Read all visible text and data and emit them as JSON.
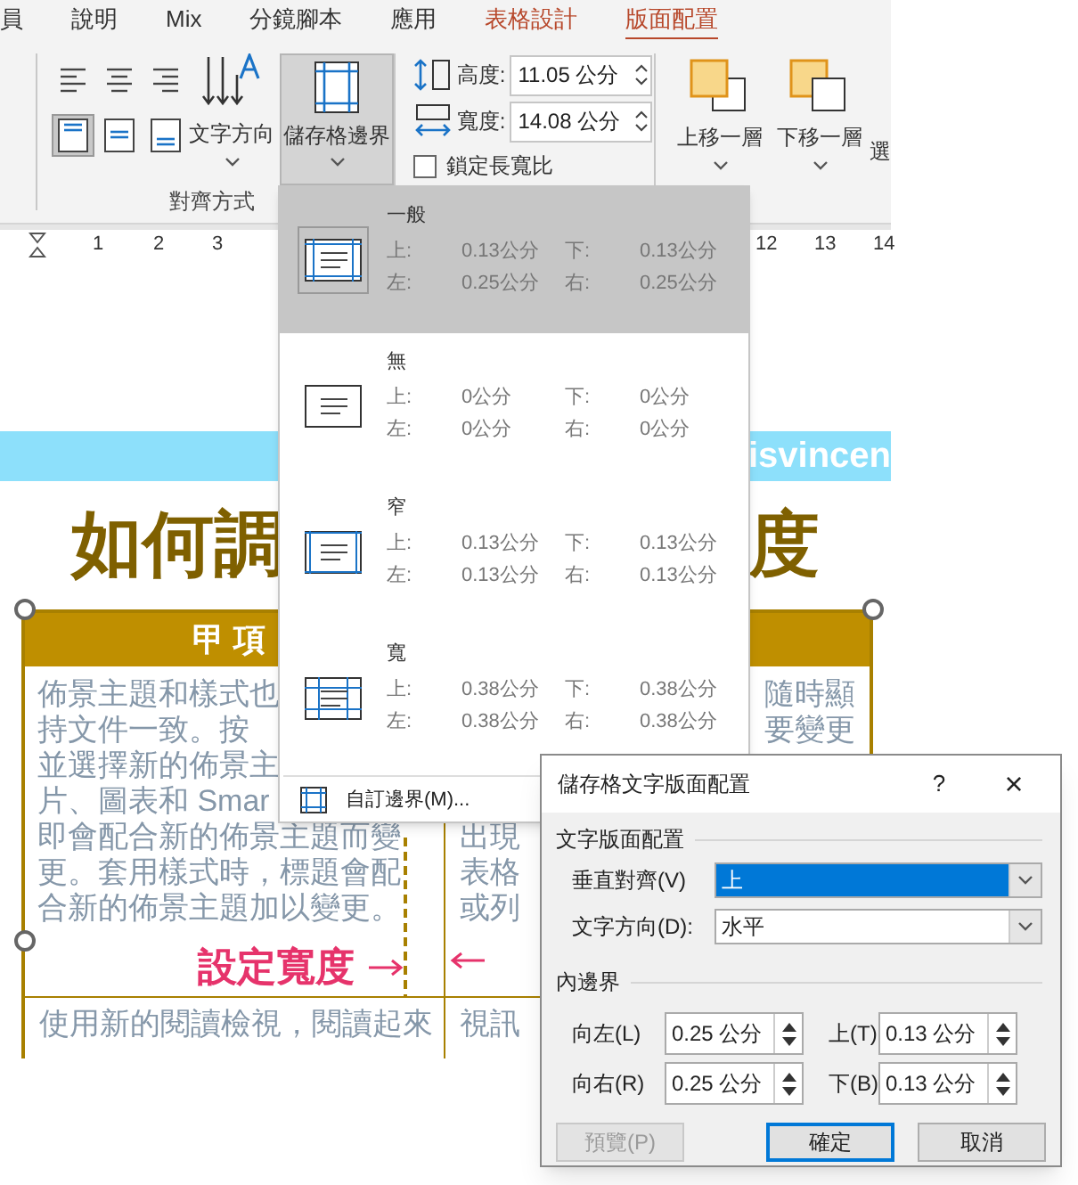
{
  "ribbon_tabs": [
    {
      "label": "員",
      "selected": false,
      "contextual": false
    },
    {
      "label": "說明",
      "selected": false,
      "contextual": false
    },
    {
      "label": "Mix",
      "selected": false,
      "contextual": false
    },
    {
      "label": "分鏡腳本",
      "selected": false,
      "contextual": false
    },
    {
      "label": "應用",
      "selected": false,
      "contextual": false
    },
    {
      "label": "表格設計",
      "selected": false,
      "contextual": true
    },
    {
      "label": "版面配置",
      "selected": true,
      "contextual": true
    }
  ],
  "ribbon": {
    "vertical_align_buttons": [
      {
        "selected": true
      },
      {
        "selected": false
      },
      {
        "selected": false
      }
    ],
    "text_direction_button": "文字方向",
    "cell_margins_button": {
      "label": "儲存格邊界",
      "pressed": true
    },
    "group_label": "對齊方式",
    "height": {
      "label": "高度:",
      "value": "11.05 公分"
    },
    "width": {
      "label": "寬度:",
      "value": "14.08 公分"
    },
    "lock_aspect": {
      "label": "鎖定長寬比",
      "checked": false
    },
    "arrange_buttons": [
      {
        "label": "上移一層",
        "kind": "forward"
      },
      {
        "label": "下移一層",
        "kind": "backward"
      },
      {
        "label": "選",
        "kind": "text"
      }
    ]
  },
  "ruler_labels": [
    "1",
    "2",
    "3",
    "12",
    "13",
    "14"
  ],
  "document": {
    "banner_text": "isvincen",
    "title_parts": [
      "如何調",
      "度"
    ],
    "table_header": "甲 項",
    "left_cell_lines": [
      "佈景主題和樣式也",
      "持文件一致。按",
      "並選擇新的佈景主",
      "片、圖表和 Smar",
      "即會配合新的佈景主題而變",
      "更。套用樣式時，標題會配",
      "合新的佈景主題加以變更。"
    ],
    "width_note": "設定寬度",
    "right_cell_top_lines": [
      "隨時顯",
      "要變更"
    ],
    "right_cell_lines": [
      "出現",
      "表格",
      "或列"
    ],
    "row_2_left": "使用新的閱讀檢視，閱讀起來",
    "row_2_right": "視訊"
  },
  "margins_menu": {
    "presets": [
      {
        "name": "一般",
        "kind": "normal",
        "selected": true,
        "fields": [
          {
            "label": "上:",
            "value": "0.13公分"
          },
          {
            "label": "下:",
            "value": "0.13公分"
          },
          {
            "label": "左:",
            "value": "0.25公分"
          },
          {
            "label": "右:",
            "value": "0.25公分"
          }
        ]
      },
      {
        "name": "無",
        "kind": "none",
        "selected": false,
        "fields": [
          {
            "label": "上:",
            "value": "0公分"
          },
          {
            "label": "下:",
            "value": "0公分"
          },
          {
            "label": "左:",
            "value": "0公分"
          },
          {
            "label": "右:",
            "value": "0公分"
          }
        ]
      },
      {
        "name": "窄",
        "kind": "narrow",
        "selected": false,
        "fields": [
          {
            "label": "上:",
            "value": "0.13公分"
          },
          {
            "label": "下:",
            "value": "0.13公分"
          },
          {
            "label": "左:",
            "value": "0.13公分"
          },
          {
            "label": "右:",
            "value": "0.13公分"
          }
        ]
      },
      {
        "name": "寬",
        "kind": "wide",
        "selected": false,
        "fields": [
          {
            "label": "上:",
            "value": "0.38公分"
          },
          {
            "label": "下:",
            "value": "0.38公分"
          },
          {
            "label": "左:",
            "value": "0.38公分"
          },
          {
            "label": "右:",
            "value": "0.38公分"
          }
        ]
      }
    ],
    "custom_item": "自訂邊界(M)..."
  },
  "dialog": {
    "title": "儲存格文字版面配置",
    "help": "?",
    "close": "×",
    "layout_section": "文字版面配置",
    "selects": [
      {
        "label": "垂直對齊(V)",
        "value": "上",
        "focused": true
      },
      {
        "label": "文字方向(D):",
        "value": "水平",
        "focused": false
      }
    ],
    "margins_section": "內邊界",
    "spinners": [
      {
        "label": "向左(L)",
        "value": "0.25 公分"
      },
      {
        "label": "上(T)",
        "value": "0.13 公分"
      },
      {
        "label": "向右(R)",
        "value": "0.25 公分"
      },
      {
        "label": "下(B)",
        "value": "0.13 公分"
      }
    ],
    "buttons": [
      {
        "label": "預覽(P)",
        "disabled": true,
        "default": false
      },
      {
        "label": "確定",
        "disabled": false,
        "default": true
      },
      {
        "label": "取消",
        "disabled": false,
        "default": false
      }
    ]
  }
}
